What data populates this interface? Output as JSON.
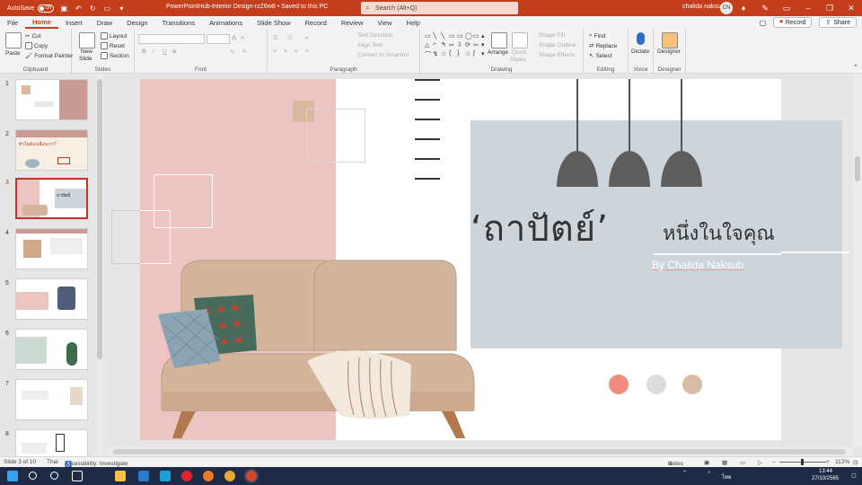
{
  "window": {
    "autosave_label": "AutoSave",
    "autosave_state": "Off",
    "title": "PowerPointHub-Interior Design-rzZ6w8 • Saved to this PC",
    "search_placeholder": "Search (Alt+Q)",
    "user_name": "chalida naksup",
    "user_initials": "CN"
  },
  "tabs": [
    "File",
    "Home",
    "Insert",
    "Draw",
    "Design",
    "Transitions",
    "Animations",
    "Slide Show",
    "Record",
    "Review",
    "View",
    "Help"
  ],
  "active_tab": "Home",
  "tab_actions": {
    "record": "Record",
    "share": "Share"
  },
  "ribbon": {
    "clipboard": {
      "paste": "Paste",
      "cut": "Cut",
      "copy": "Copy",
      "format_painter": "Format Painter",
      "label": "Clipboard"
    },
    "slides": {
      "new_slide": "New",
      "new_slide_2": "Slide",
      "layout": "Layout",
      "reset": "Reset",
      "section": "Section",
      "label": "Slides"
    },
    "font": {
      "label": "Font",
      "bold": "B",
      "italic": "I",
      "underline": "U",
      "strike": "S",
      "grow": "A",
      "shrink": "A"
    },
    "paragraph": {
      "label": "Paragraph",
      "text_direction": "Text Direction",
      "align_text": "Align Text",
      "convert_smartart": "Convert to SmartArt"
    },
    "drawing": {
      "label": "Drawing",
      "arrange": "Arrange",
      "quick_styles": "Quick",
      "quick_styles_2": "Styles",
      "shape_fill": "Shape Fill",
      "shape_outline": "Shape Outline",
      "shape_effects": "Shape Effects"
    },
    "editing": {
      "label": "Editing",
      "find": "Find",
      "replace": "Replace",
      "select": "Select"
    },
    "voice": {
      "label": "Voice",
      "dictate": "Dictate"
    },
    "designer": {
      "label": "Designer",
      "designer": "Designer"
    }
  },
  "thumbnails": [
    {
      "number": "1",
      "title": ""
    },
    {
      "number": "2",
      "title": "ทำไมต้องเลือกเรา?"
    },
    {
      "number": "3",
      "title": "ถาปัตย์"
    },
    {
      "number": "4",
      "title": ""
    },
    {
      "number": "5",
      "title": ""
    },
    {
      "number": "6",
      "title": ""
    },
    {
      "number": "7",
      "title": ""
    },
    {
      "number": "8",
      "title": ""
    }
  ],
  "selected_slide": 3,
  "slide": {
    "title": "‘ถาปัตย์’",
    "subtitle": "หนึ่งในใจคุณ",
    "byline": "By Chalida  Naksub"
  },
  "colors": {
    "accent": "#c43e1c",
    "pink_panel": "#ecc5c2",
    "blue_box": "#cdd4da",
    "sofa": "#d4b59b",
    "lamp": "#5e5e5e",
    "dot1": "#f28b80",
    "dot2": "#dcdcdc",
    "dot3": "#d7bca3"
  },
  "status": {
    "slide_info": "Slide 3 of 10",
    "language": "Thai",
    "accessibility": "Accessibility: Investigate",
    "notes": "Notes",
    "zoom": "112%"
  },
  "taskbar": {
    "language": "ไทย",
    "clock_time": "13:44",
    "clock_date": "27/10/2565"
  }
}
